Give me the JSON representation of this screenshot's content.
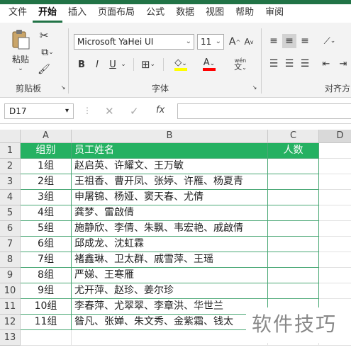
{
  "ribbon_tabs": [
    "文件",
    "开始",
    "插入",
    "页面布局",
    "公式",
    "数据",
    "视图",
    "帮助",
    "审阅"
  ],
  "active_tab": "开始",
  "clipboard": {
    "paste_label": "粘贴",
    "group_label": "剪贴板"
  },
  "font": {
    "name": "Microsoft YaHei UI",
    "size": "11",
    "group_label": "字体",
    "bold": "B",
    "italic": "I",
    "underline": "U",
    "inc": "A",
    "dec": "A",
    "pinyin": "wén"
  },
  "align": {
    "group_label": "对齐方"
  },
  "formula_bar": {
    "name_box": "D17",
    "fx": "fx",
    "value": ""
  },
  "columns": [
    "A",
    "B",
    "C",
    "D"
  ],
  "rows": [
    "1",
    "2",
    "3",
    "4",
    "5",
    "6",
    "7",
    "8",
    "9",
    "10",
    "11",
    "12",
    "13"
  ],
  "table": {
    "headers": [
      "组别",
      "员工姓名",
      "人数"
    ],
    "data": [
      [
        "1组",
        "赵启英、许耀文、王万敏",
        ""
      ],
      [
        "2组",
        "王祖香、曹开凤、张婷、许雁、杨夏青",
        ""
      ],
      [
        "3组",
        "申屠锦、杨娅、窦天春、尤倩",
        ""
      ],
      [
        "4组",
        "龚梦、雷啟倩",
        ""
      ],
      [
        "5组",
        "施静欣、李倩、朱飘、韦宏艳、戚啟倩",
        ""
      ],
      [
        "6组",
        "邱成龙、沈虹霖",
        ""
      ],
      [
        "7组",
        "褚鑫琳、卫太群、戚雪萍、王瑶",
        ""
      ],
      [
        "8组",
        "严娣、王寒雁",
        ""
      ],
      [
        "9组",
        "尤开萍、赵珍、姜尔珍",
        ""
      ],
      [
        "10组",
        "李春萍、尤翠翠、李章洪、华世兰",
        ""
      ],
      [
        "11组",
        "昝凡、张婵、朱文秀、金紫霜、钱太",
        ""
      ]
    ]
  },
  "watermark": "软件技巧",
  "colors": {
    "excel_green": "#217346",
    "header_fill": "#25b162",
    "border_green": "#4aa875"
  }
}
